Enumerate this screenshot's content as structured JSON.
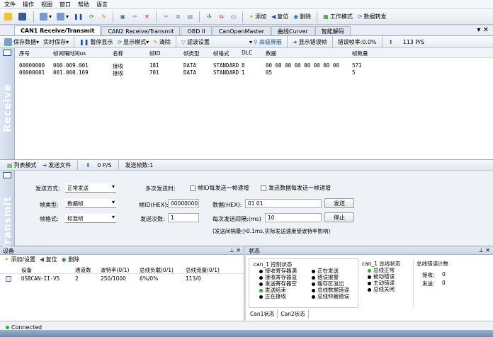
{
  "menu": [
    "文件",
    "操作",
    "视图",
    "窗口",
    "帮助",
    "语言"
  ],
  "toolbar": {
    "add": "添加",
    "reset": "复位",
    "delete": "删除",
    "workmode": "工作模式",
    "forward": "数据转发"
  },
  "tabs": [
    "CAN1 Receive/Transmit",
    "CAN2 Receive/Transmit",
    "OBD II",
    "CanOpenMaster",
    "曲线Curver",
    "智能解码"
  ],
  "subtool": {
    "save": "保存数据",
    "realtime_save": "实时保存",
    "pause": "暂停显示",
    "display_mode": "显示模式",
    "clear": "清除",
    "filter": "滤波设置",
    "advanced": "高级屏蔽",
    "show_err": "显示错误帧",
    "err_rate": "错误帧率:0.0%",
    "rate": "113 P/S"
  },
  "receive": {
    "side_label": "Receive",
    "headers": [
      "序号",
      "帧间隔时间us",
      "名称",
      "帧ID",
      "帧类型",
      "帧格式",
      "DLC",
      "数据",
      "帧数量"
    ],
    "rows": [
      [
        "00000000",
        "000.009.001",
        "接收",
        "181",
        "DATA",
        "STANDARD",
        "8",
        "00 00 00 00 00 00 00 00",
        "571"
      ],
      [
        "00000001",
        "001.000.169",
        "接收",
        "701",
        "DATA",
        "STANDARD",
        "1",
        "05",
        "5"
      ]
    ]
  },
  "bar2": {
    "list_mode": "列表模式",
    "send_file": "发送文件",
    "ps": "0 P/S",
    "send_count": "发送帧数:1"
  },
  "send": {
    "side_label": "Transmit",
    "mode_label": "发送方式:",
    "mode_value": "正常发送",
    "multi_label": "多次发送时:",
    "chk1": "帧ID每发送一帧递增",
    "chk2": "发送数据每发送一帧递增",
    "frame_type_label": "帧类型:",
    "frame_type_value": "数据帧",
    "frame_id_label": "帧ID(HEX):",
    "frame_id_value": "00000000",
    "data_label": "数据(HEX):",
    "data_value": "01 01",
    "send_btn": "发送",
    "frame_fmt_label": "帧格式:",
    "frame_fmt_value": "标准帧",
    "send_times_label": "发送次数:",
    "send_times_value": "1",
    "interval_label": "每次发送间隔:(ms)",
    "interval_value": "10",
    "stop_btn": "停止",
    "note": "(发送间隔最小0.1ms,实际发送速度受波特率影响)"
  },
  "device": {
    "title": "设备",
    "add": "添加/设置",
    "reset": "复位",
    "delete": "删除",
    "headers": [
      "设备",
      "通道数",
      "波特率(0/1)",
      "总线负载(0/1)",
      "总线流量(0/1)"
    ],
    "row": [
      "USBCAN-II-V5",
      "2",
      "250/1000",
      "6%/0%",
      "113/0"
    ]
  },
  "state": {
    "title": "状态",
    "ctrl_title": "can_1 控制状态",
    "ctrl_left": [
      "接收寄存器满",
      "接收寄存器溢",
      "发送寄存器空",
      "发送结束",
      "正在接收"
    ],
    "ctrl_right": [
      "正在发送",
      "错误报警",
      "缓存区溢出",
      "总线数据错误",
      "总线仲裁错误"
    ],
    "bus_title": "can_1 总线状态",
    "bus": [
      "总线正常",
      "被动错误",
      "主动错误",
      "总线关闭"
    ],
    "err_title": "总线错误计数",
    "recv_label": "接收:",
    "recv_val": "0",
    "send_label": "发送:",
    "send_val": "0",
    "tabs": [
      "Can1状态",
      "Can2状态"
    ]
  },
  "statusbar": {
    "text": "Connected"
  }
}
